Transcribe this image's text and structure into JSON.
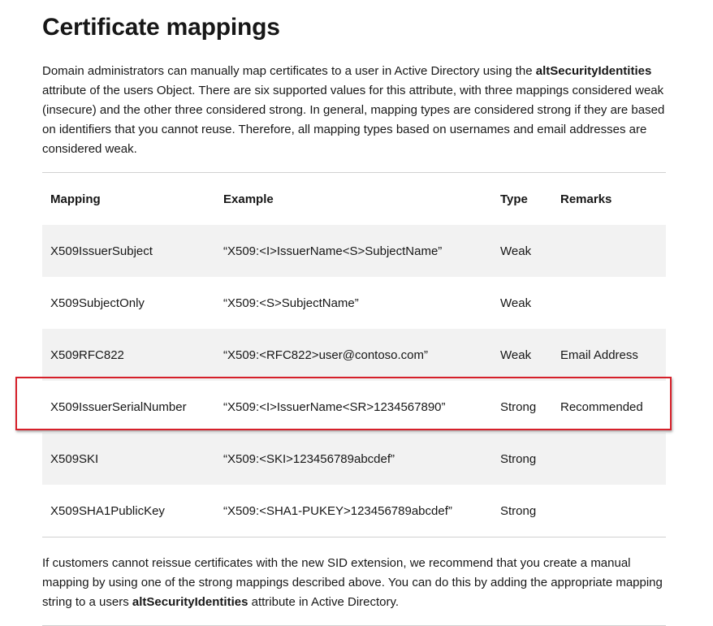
{
  "title": "Certificate mappings",
  "intro": {
    "part1": "Domain administrators can manually map certificates to a user in Active Directory using the ",
    "bold": "altSecurityIdentities",
    "part2": " attribute of the users Object. There are six supported values for this attribute, with three mappings considered weak (insecure) and the other three considered strong. In general, mapping types are considered strong if they are based on identifiers that you cannot reuse. Therefore, all mapping types based on usernames and email addresses are considered weak."
  },
  "table": {
    "headers": {
      "mapping": "Mapping",
      "example": "Example",
      "type": "Type",
      "remarks": "Remarks"
    },
    "rows": [
      {
        "mapping": "X509IssuerSubject",
        "example": "“X509:<I>IssuerName<S>SubjectName”",
        "type": "Weak",
        "remarks": ""
      },
      {
        "mapping": "X509SubjectOnly",
        "example": "“X509:<S>SubjectName”",
        "type": "Weak",
        "remarks": ""
      },
      {
        "mapping": "X509RFC822",
        "example": "“X509:<RFC822>user@contoso.com”",
        "type": "Weak",
        "remarks": "Email Address"
      },
      {
        "mapping": "X509IssuerSerialNumber",
        "example": "“X509:<I>IssuerName<SR>1234567890”",
        "type": "Strong",
        "remarks": "Recommended"
      },
      {
        "mapping": "X509SKI",
        "example": "“X509:<SKI>123456789abcdef”",
        "type": "Strong",
        "remarks": ""
      },
      {
        "mapping": "X509SHA1PublicKey",
        "example": "“X509:<SHA1-PUKEY>123456789abcdef”",
        "type": "Strong",
        "remarks": ""
      }
    ]
  },
  "outro": {
    "part1": "If customers cannot reissue certificates with the new SID extension, we recommend that you create a manual mapping by using one of the strong mappings described above. You can do this by adding the appropriate mapping string to a users ",
    "bold": "altSecurityIdentities",
    "part2": " attribute in Active Directory."
  },
  "colors": {
    "highlight": "#d6202a",
    "stripe": "#f2f2f2",
    "rule": "#d1d1d1"
  }
}
